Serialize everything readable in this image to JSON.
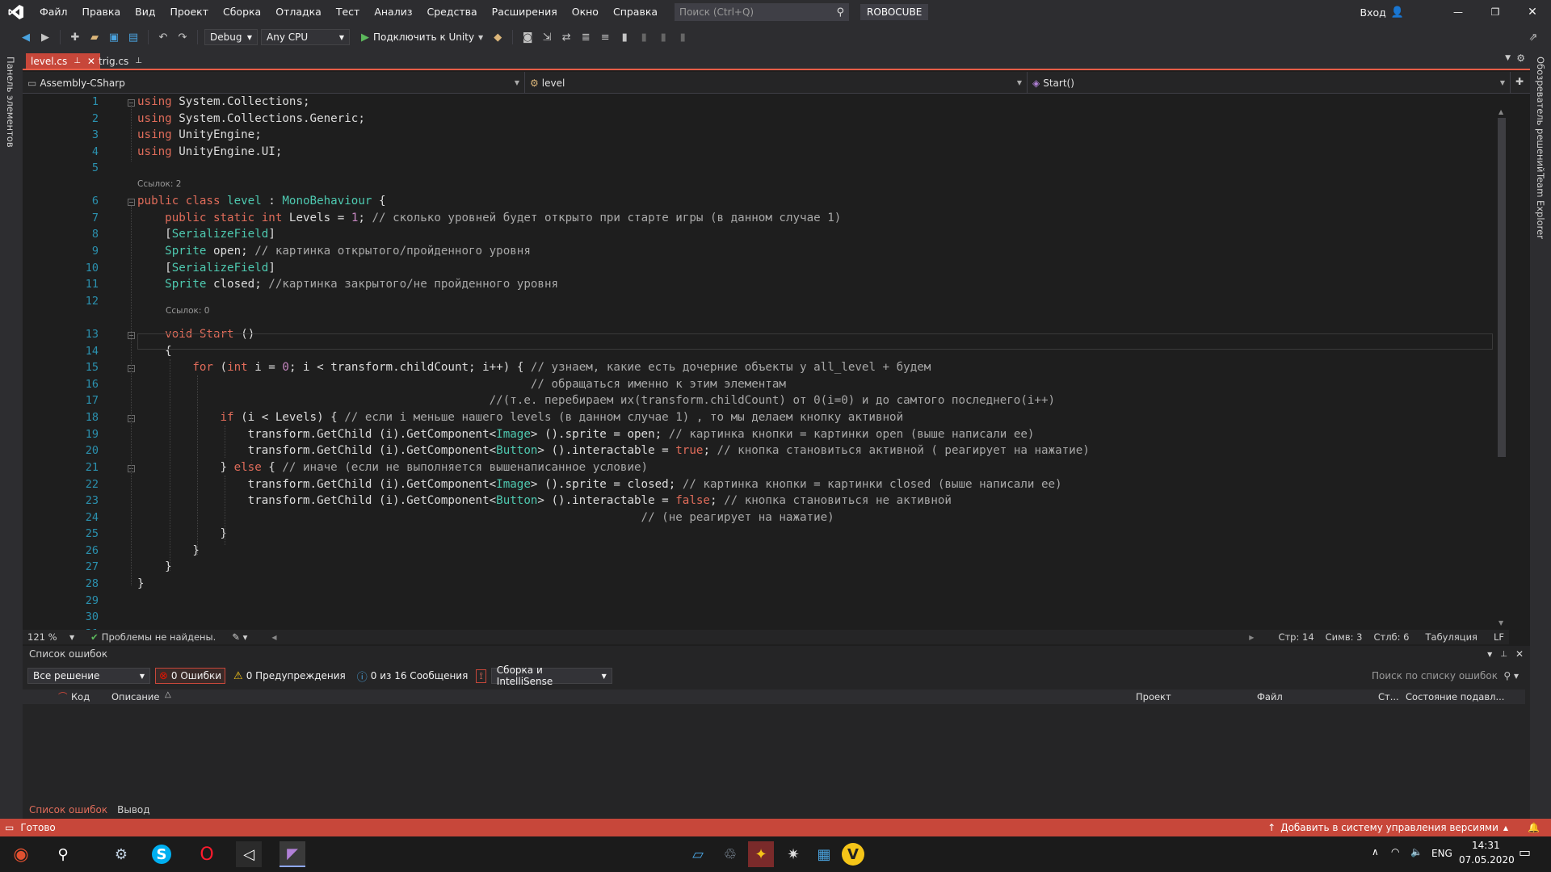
{
  "title_bar": {
    "menu": [
      "Файл",
      "Правка",
      "Вид",
      "Проект",
      "Сборка",
      "Отладка",
      "Тест",
      "Анализ",
      "Средства",
      "Расширения",
      "Окно",
      "Справка"
    ],
    "search_placeholder": "Поиск (Ctrl+Q)",
    "solution_name": "ROBOCUBE",
    "signin": "Вход"
  },
  "toolbar": {
    "config": "Debug",
    "platform": "Any CPU",
    "attach_unity": "Подключить к Unity"
  },
  "left_panel": {
    "toolbox": "Панель элементов"
  },
  "right_panel": {
    "solution_explorer": "Обозреватель решений",
    "team_explorer": "Team Explorer"
  },
  "tabs": [
    {
      "label": "level.cs",
      "active": true
    },
    {
      "label": "trig.cs",
      "active": false
    }
  ],
  "navbar": {
    "project": "Assembly-CSharp",
    "type": "level",
    "member": "Start()"
  },
  "code": {
    "lens_class": "Ссылок: 2",
    "lens_method": "Ссылок: 0",
    "line_numbers": [
      "1",
      "2",
      "3",
      "4",
      "5",
      "6",
      "7",
      "8",
      "9",
      "10",
      "11",
      "12",
      "13",
      "14",
      "15",
      "16",
      "17",
      "18",
      "19",
      "20",
      "21",
      "22",
      "23",
      "24",
      "25",
      "26",
      "27",
      "28",
      "29",
      "30",
      "31"
    ],
    "lines": [
      [
        [
          "kw",
          "using"
        ],
        [
          "id",
          " System.Collections;"
        ]
      ],
      [
        [
          "kw",
          "using"
        ],
        [
          "id",
          " System.Collections.Generic;"
        ]
      ],
      [
        [
          "kw",
          "using"
        ],
        [
          "id",
          " UnityEngine;"
        ]
      ],
      [
        [
          "kw",
          "using"
        ],
        [
          "id",
          " UnityEngine.UI;"
        ]
      ],
      [],
      [
        [
          "kw",
          "public class "
        ],
        [
          "ty",
          "level"
        ],
        [
          "id",
          " : "
        ],
        [
          "ty",
          "MonoBehaviour"
        ],
        [
          "id",
          " {"
        ]
      ],
      [
        [
          "id",
          "    "
        ],
        [
          "kw",
          "public static int"
        ],
        [
          "id",
          " Levels = "
        ],
        [
          "nm",
          "1"
        ],
        [
          "id",
          "; "
        ],
        [
          "cm",
          "// сколько уровней будет открыто при старте игры (в данном случае 1)"
        ]
      ],
      [
        [
          "id",
          "    ["
        ],
        [
          "ty",
          "SerializeField"
        ],
        [
          "id",
          "]"
        ]
      ],
      [
        [
          "id",
          "    "
        ],
        [
          "ty",
          "Sprite"
        ],
        [
          "id",
          " open; "
        ],
        [
          "cm",
          "// картинка открытого/пройденного уровня"
        ]
      ],
      [
        [
          "id",
          "    ["
        ],
        [
          "ty",
          "SerializeField"
        ],
        [
          "id",
          "]"
        ]
      ],
      [
        [
          "id",
          "    "
        ],
        [
          "ty",
          "Sprite"
        ],
        [
          "id",
          " closed; "
        ],
        [
          "cm",
          "//картинка закрытого/не пройденного уровня"
        ]
      ],
      [],
      [
        [
          "id",
          "    "
        ],
        [
          "kw",
          "void"
        ],
        [
          "id",
          " "
        ],
        [
          "kw",
          "Start"
        ],
        [
          "id",
          " ()"
        ]
      ],
      [
        [
          "id",
          "    {"
        ]
      ],
      [
        [
          "id",
          "        "
        ],
        [
          "kw",
          "for"
        ],
        [
          "id",
          " ("
        ],
        [
          "kw",
          "int"
        ],
        [
          "id",
          " i = "
        ],
        [
          "nm",
          "0"
        ],
        [
          "id",
          "; i < transform.childCount; i++) { "
        ],
        [
          "cm",
          "// узнаем, какие есть дочерние объекты у all_level + будем"
        ]
      ],
      [
        [
          "cm",
          "                                                         // обращаться именно к этим элементам"
        ]
      ],
      [
        [
          "cm",
          "                                                   //(т.е. перебираем их(transform.childCount) от 0(i=0) и до самтого последнего(i++)"
        ]
      ],
      [
        [
          "id",
          "            "
        ],
        [
          "kw",
          "if"
        ],
        [
          "id",
          " (i < Levels) { "
        ],
        [
          "cm",
          "// если i меньше нашего levels (в данном случае 1) , то мы делаем кнопку активной"
        ]
      ],
      [
        [
          "id",
          "                transform.GetChild (i).GetComponent<"
        ],
        [
          "ty",
          "Image"
        ],
        [
          "id",
          "> ().sprite = open; "
        ],
        [
          "cm",
          "// картинка кнопки = картинки open (выше написали ее)"
        ]
      ],
      [
        [
          "id",
          "                transform.GetChild (i).GetComponent<"
        ],
        [
          "ty",
          "Button"
        ],
        [
          "id",
          "> ().interactable = "
        ],
        [
          "kw",
          "true"
        ],
        [
          "id",
          "; "
        ],
        [
          "cm",
          "// кнопка становиться активной ( реагирует на нажатие)"
        ]
      ],
      [
        [
          "id",
          "            } "
        ],
        [
          "kw",
          "else"
        ],
        [
          "id",
          " { "
        ],
        [
          "cm",
          "// иначе (если не выполняется вышенаписанное условие)"
        ]
      ],
      [
        [
          "id",
          "                transform.GetChild (i).GetComponent<"
        ],
        [
          "ty",
          "Image"
        ],
        [
          "id",
          "> ().sprite = closed; "
        ],
        [
          "cm",
          "// картинка кнопки = картинки closed (выше написали ее)"
        ]
      ],
      [
        [
          "id",
          "                transform.GetChild (i).GetComponent<"
        ],
        [
          "ty",
          "Button"
        ],
        [
          "id",
          "> ().interactable = "
        ],
        [
          "kw",
          "false"
        ],
        [
          "id",
          "; "
        ],
        [
          "cm",
          "// кнопка становиться не активной"
        ]
      ],
      [
        [
          "cm",
          "                                                                         // (не реагирует на нажатие)"
        ]
      ],
      [
        [
          "id",
          "            }"
        ]
      ],
      [
        [
          "id",
          "        }"
        ]
      ],
      [
        [
          "id",
          "    }"
        ]
      ],
      [
        [
          "id",
          "}"
        ]
      ],
      [],
      [],
      []
    ]
  },
  "editor_status": {
    "zoom": "121 %",
    "problems": "Проблемы не найдены.",
    "line": "Стр: 14",
    "char": "Симв: 3",
    "col": "Стлб: 6",
    "tabs": "Табуляция",
    "eol": "LF"
  },
  "error_list": {
    "title": "Список ошибок",
    "scope": "Все решение",
    "errors": "0 Ошибки",
    "warnings": "0 Предупреждения",
    "messages": "0 из 16 Сообщения",
    "source": "Сборка и IntelliSense",
    "search_placeholder": "Поиск по списку ошибок",
    "columns": {
      "code": "Код",
      "description": "Описание",
      "project": "Проект",
      "file": "Файл",
      "line": "Ст...",
      "state": "Состояние подавл..."
    },
    "bottom_tabs": [
      "Список ошибок",
      "Вывод"
    ]
  },
  "status_bar": {
    "ready": "Готово",
    "vcs": "Добавить в систему управления версиями"
  },
  "taskbar": {
    "lang": "ENG",
    "time": "14:31",
    "date": "07.05.2020"
  },
  "colors": {
    "accent": "#c7473a",
    "tab_active": "#c7473a",
    "keyword": "#e06c5a",
    "type": "#4ec9b0"
  }
}
